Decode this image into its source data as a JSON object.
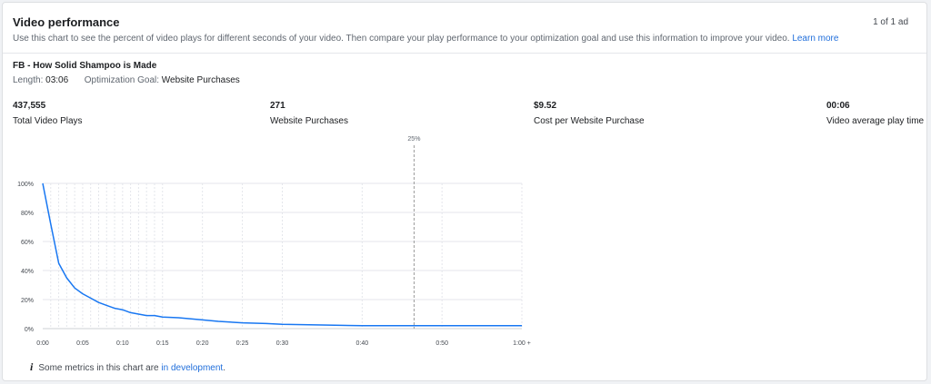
{
  "header": {
    "title": "Video performance",
    "pagination": "1 of 1 ad",
    "description": "Use this chart to see the percent of video plays for different seconds of your video. Then compare your play performance to your optimization goal and use this information to improve your video.",
    "learn_more": "Learn more"
  },
  "ad": {
    "name": "FB - How Solid Shampoo is Made",
    "length_label": "Length:",
    "length_value": "03:06",
    "goal_label": "Optimization Goal:",
    "goal_value": "Website Purchases"
  },
  "metrics": [
    {
      "value": "437,555",
      "label": "Total Video Plays"
    },
    {
      "value": "271",
      "label": "Website Purchases"
    },
    {
      "value": "$9.52",
      "label": "Cost per Website Purchase"
    },
    {
      "value": "00:06",
      "label": "Video average play time"
    }
  ],
  "note": {
    "icon": "info-icon",
    "text": "Some metrics in this chart are ",
    "link": "in development",
    "suffix": "."
  },
  "colors": {
    "line": "#1877f2",
    "grid": "#e4e6eb",
    "marker": "#9a9a9a",
    "link": "#216fdb"
  },
  "chart_data": {
    "type": "line",
    "x_max_seconds": 60,
    "y_range": [
      0,
      100
    ],
    "y_ticks": [
      {
        "value": 0,
        "label": "0%"
      },
      {
        "value": 20,
        "label": "20%"
      },
      {
        "value": 40,
        "label": "40%"
      },
      {
        "value": 60,
        "label": "60%"
      },
      {
        "value": 80,
        "label": "80%"
      },
      {
        "value": 100,
        "label": "100%"
      }
    ],
    "x_ticks": [
      {
        "value": 0,
        "label": "0:00"
      },
      {
        "value": 5,
        "label": "0:05"
      },
      {
        "value": 10,
        "label": "0:10"
      },
      {
        "value": 15,
        "label": "0:15"
      },
      {
        "value": 20,
        "label": "0:20"
      },
      {
        "value": 25,
        "label": "0:25"
      },
      {
        "value": 30,
        "label": "0:30"
      },
      {
        "value": 40,
        "label": "0:40"
      },
      {
        "value": 50,
        "label": "0:50"
      },
      {
        "value": 60,
        "label": "1:00 +"
      }
    ],
    "minor_gridlines_x": [
      1,
      2,
      3,
      4,
      6,
      7,
      8,
      9,
      11,
      12,
      13,
      14
    ],
    "marker": {
      "x": 46.5,
      "label": "25%"
    },
    "x": [
      0,
      1,
      2,
      3,
      4,
      5,
      6,
      7,
      8,
      9,
      10,
      11,
      12,
      13,
      14,
      15,
      17,
      20,
      22,
      25,
      28,
      30,
      35,
      40,
      45,
      50,
      55,
      60
    ],
    "y": [
      100,
      72,
      45,
      35,
      28,
      24,
      21,
      18,
      16,
      14,
      13,
      11,
      10,
      9,
      9,
      8,
      7.5,
      6,
      5,
      4,
      3.5,
      3,
      2.5,
      2,
      2,
      2,
      2,
      2
    ]
  }
}
